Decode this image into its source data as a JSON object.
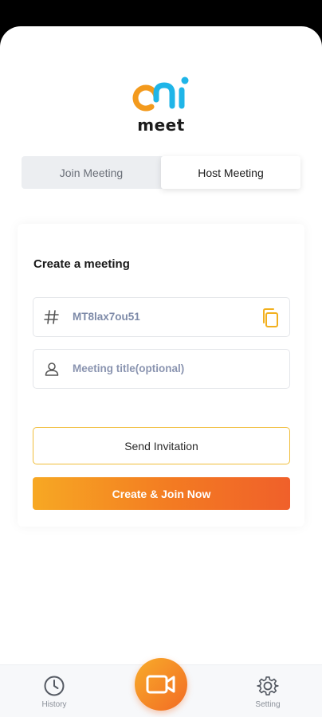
{
  "app": {
    "logo_text": "meet"
  },
  "tabs": [
    {
      "label": "Join Meeting",
      "active": false
    },
    {
      "label": "Host Meeting",
      "active": true
    }
  ],
  "card": {
    "title": "Create a meeting",
    "meeting_id": {
      "icon": "hash-icon",
      "value": "MT8lax7ou51"
    },
    "meeting_title": {
      "icon": "user-icon",
      "placeholder": "Meeting title(optional)",
      "value": ""
    },
    "send_invitation_label": "Send Invitation",
    "create_join_label": "Create & Join Now"
  },
  "bottom_nav": {
    "history_label": "History",
    "setting_label": "Setting"
  },
  "colors": {
    "accent_orange": "#f37a22",
    "accent_yellow": "#f7a823",
    "logo_blue": "#1fb5e8"
  }
}
